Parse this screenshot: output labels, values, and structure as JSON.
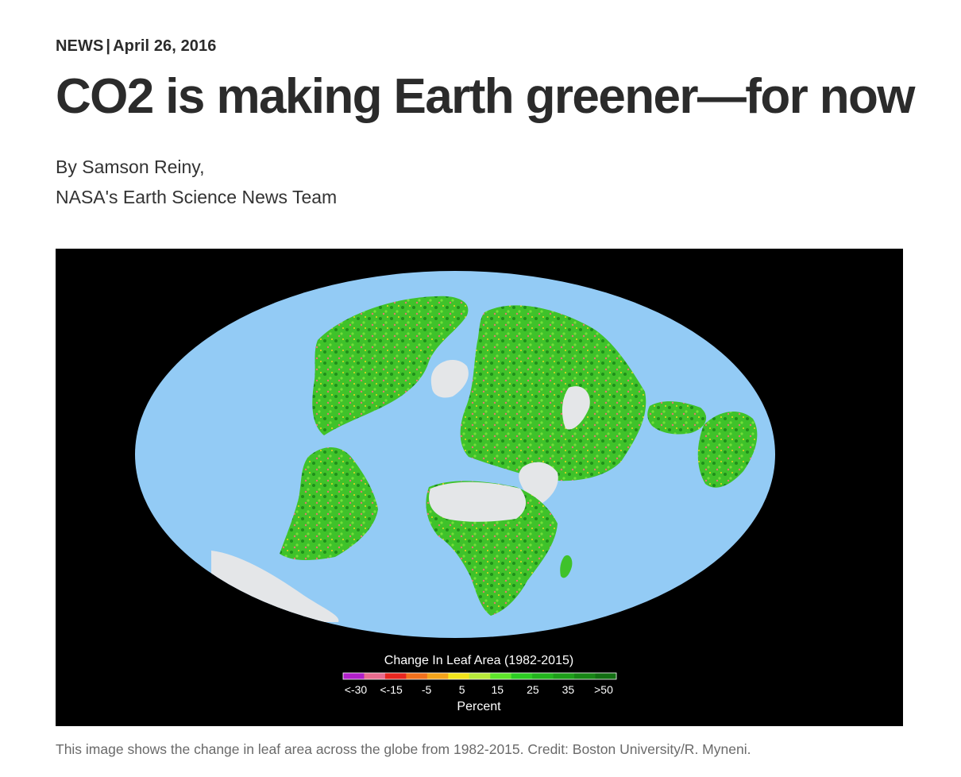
{
  "article": {
    "section": "NEWS",
    "separator": "|",
    "date": "April 26, 2016",
    "headline": "CO2 is making Earth greener—for now",
    "byline_author": "By Samson Reiny,",
    "byline_team": "NASA's Earth Science News Team"
  },
  "figure": {
    "legend_title": "Change In Leaf Area (1982-2015)",
    "legend_ticks": [
      "<-30",
      "<-15",
      "-5",
      "5",
      "15",
      "25",
      "35",
      ">50"
    ],
    "legend_unit": "Percent",
    "legend_colors": [
      "#b01fc9",
      "#e86b8e",
      "#e8261f",
      "#f2701c",
      "#f3a31a",
      "#f2e41b",
      "#b7ea3a",
      "#5ee52a",
      "#2ccd22",
      "#22b51d",
      "#1d9e19",
      "#178615",
      "#126f12"
    ],
    "colors": {
      "ocean": "#93cbf5",
      "background": "#000000",
      "land_green": "#3fc22a",
      "ice": "#e4e6e8"
    },
    "caption": "This image shows the change in leaf area across the globe from 1982-2015. Credit: Boston University/R. Myneni."
  }
}
